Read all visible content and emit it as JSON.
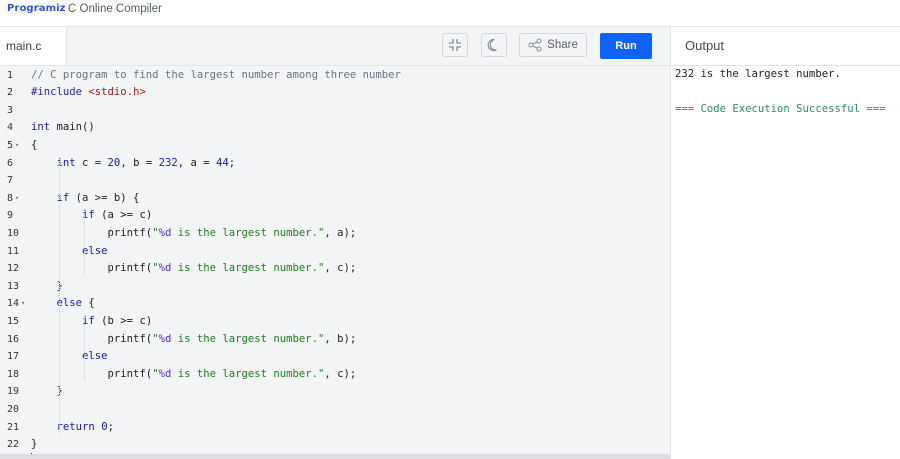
{
  "app": {
    "logo_text": "Programiz",
    "title": "C Online Compiler"
  },
  "editor": {
    "file_tab": "main.c",
    "share_label": "Share",
    "run_label": "Run",
    "lines": [
      "// C program to find the largest number among three number",
      "#include <stdio.h>",
      "",
      "int main()",
      "{",
      "    int c = 20, b = 232, a = 44;",
      "",
      "    if (a >= b) {",
      "        if (a >= c)",
      "            printf(\"%d is the largest number.\", a);",
      "        else",
      "            printf(\"%d is the largest number.\", c);",
      "    }",
      "    else {",
      "        if (b >= c)",
      "            printf(\"%d is the largest number.\", b);",
      "        else",
      "            printf(\"%d is the largest number.\", c);",
      "    }",
      "",
      "    return 0;",
      "}"
    ],
    "line_numbers": [
      "1",
      "2",
      "3",
      "4",
      "5",
      "6",
      "7",
      "8",
      "9",
      "10",
      "11",
      "12",
      "13",
      "14",
      "15",
      "16",
      "17",
      "18",
      "19",
      "20",
      "21",
      "22"
    ],
    "fold_lines": [
      5,
      8,
      14
    ]
  },
  "output": {
    "header": "Output",
    "result_line": "232 is the largest number.",
    "status_line": "=== Code Execution Successful ==="
  },
  "colors": {
    "run_button": "#0f62fe",
    "logo": "#2a54d6",
    "success_text": "#2c8a6a"
  },
  "icons": [
    "fullscreen-exit-icon",
    "moon-icon",
    "share-icon"
  ]
}
